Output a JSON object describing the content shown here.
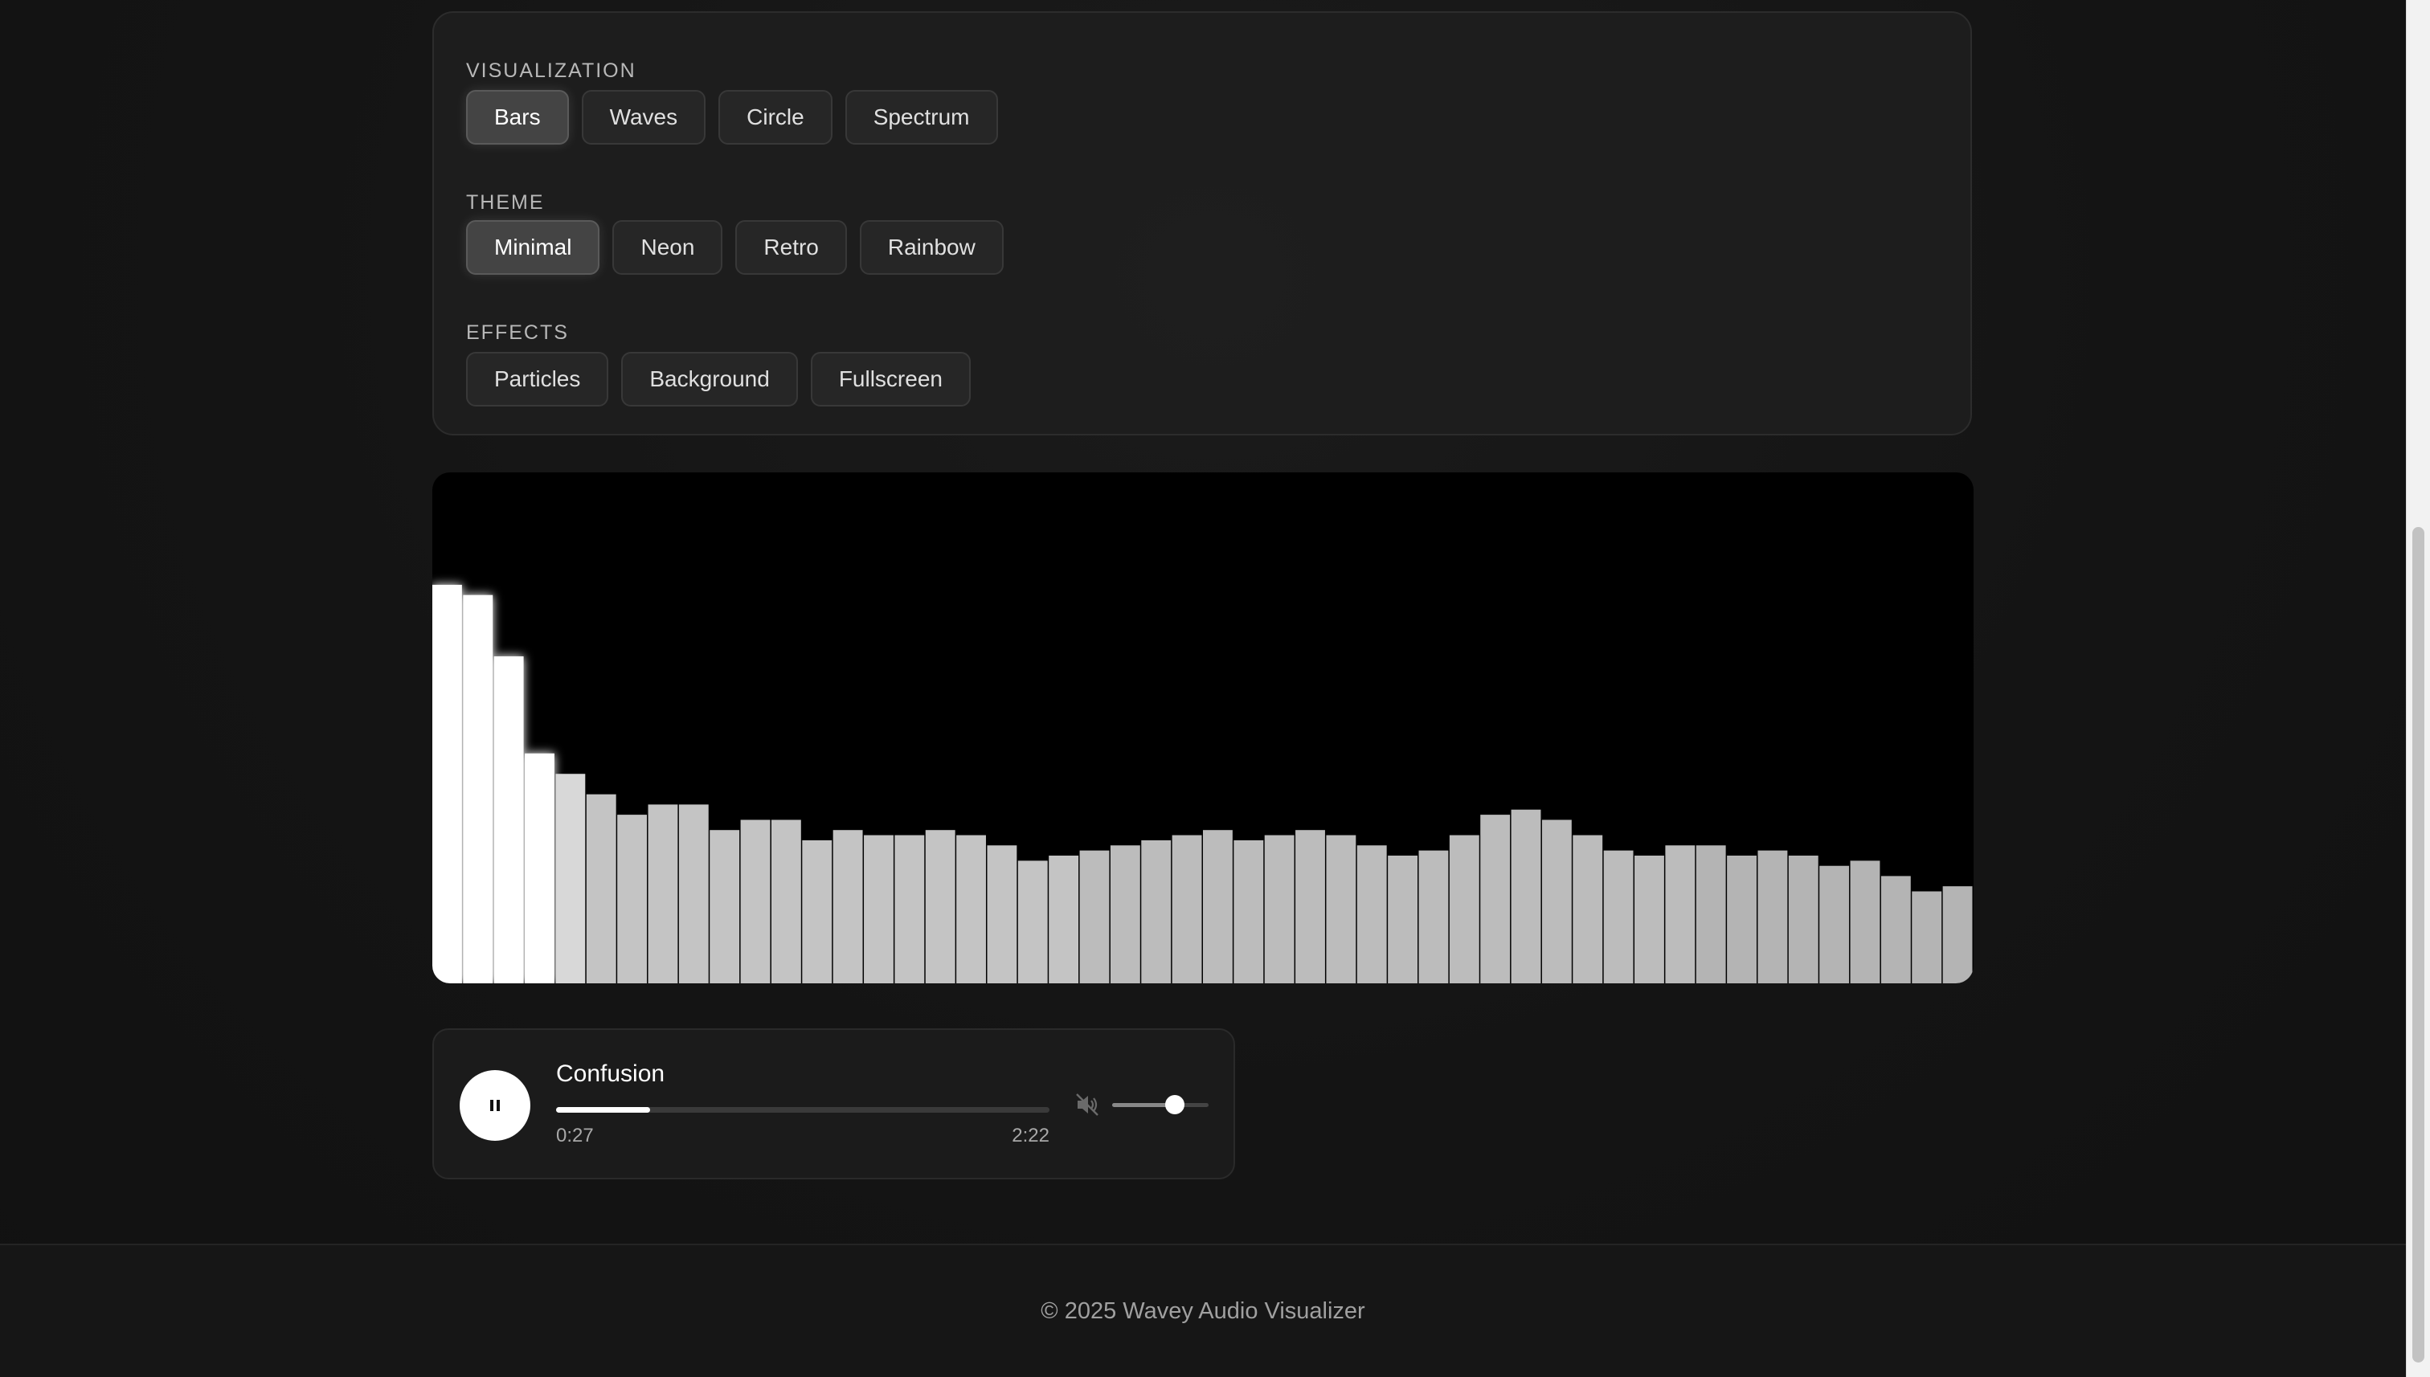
{
  "controls": {
    "visualization": {
      "label": "VISUALIZATION",
      "options": [
        "Bars",
        "Waves",
        "Circle",
        "Spectrum"
      ],
      "selected": "Bars"
    },
    "theme": {
      "label": "THEME",
      "options": [
        "Minimal",
        "Neon",
        "Retro",
        "Rainbow"
      ],
      "selected": "Minimal"
    },
    "effects": {
      "label": "EFFECTS",
      "options": [
        "Particles",
        "Background",
        "Fullscreen"
      ]
    }
  },
  "visualizer": {
    "mode": "bars",
    "levels": [
      0.78,
      0.76,
      0.64,
      0.45,
      0.41,
      0.37,
      0.33,
      0.35,
      0.35,
      0.3,
      0.32,
      0.32,
      0.28,
      0.3,
      0.29,
      0.29,
      0.3,
      0.29,
      0.27,
      0.24,
      0.25,
      0.26,
      0.27,
      0.28,
      0.29,
      0.3,
      0.28,
      0.29,
      0.3,
      0.29,
      0.27,
      0.25,
      0.26,
      0.29,
      0.33,
      0.34,
      0.32,
      0.29,
      0.26,
      0.25,
      0.27,
      0.27,
      0.25,
      0.26,
      0.25,
      0.23,
      0.24,
      0.21,
      0.18,
      0.19
    ]
  },
  "player": {
    "title": "Confusion",
    "current_time": "0:27",
    "total_time": "2:22",
    "progress": 0.19,
    "volume": 0.65,
    "play_state_icon": "pause-icon",
    "volume_icon": "speaker-muted-icon"
  },
  "footer": {
    "text": "© 2025 Wavey Audio Visualizer"
  }
}
